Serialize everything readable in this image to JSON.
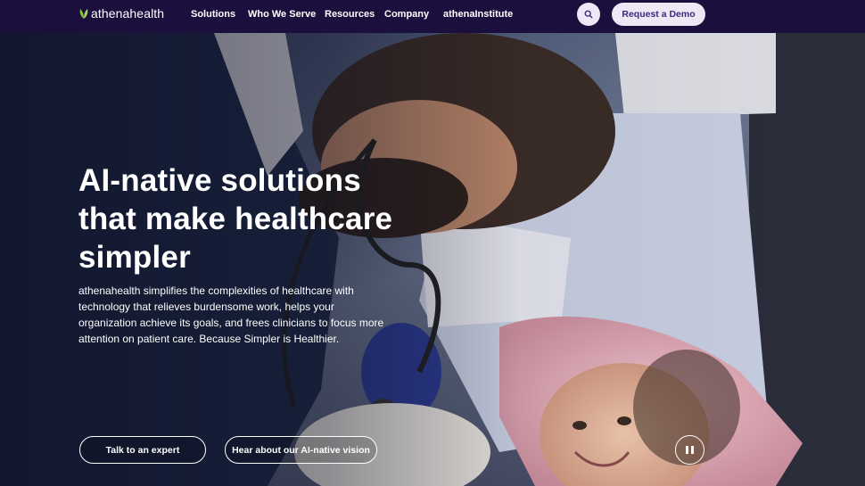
{
  "nav": {
    "logo_text": "athenahealth",
    "links": [
      "Solutions",
      "Who We Serve",
      "Resources",
      "Company",
      "athenaInstitute"
    ],
    "search_icon": "search-icon",
    "demo_label": "Request a Demo"
  },
  "hero": {
    "headline": "AI-native solutions that make healthcare simpler",
    "body": "athenahealth simplifies the complexities of healthcare with technology that relieves burdensome work, helps your organization achieve its goals, and frees clinicians to focus more attention on patient care. Because Simpler is Healthier.",
    "cta_primary": "Talk to an expert",
    "cta_secondary": "Hear about our AI-native vision",
    "pause_icon": "pause-icon"
  },
  "colors": {
    "nav_bg": "#1b0f3d",
    "button_bg": "#ece8f6",
    "button_text": "#3d2a7a",
    "logo_leaf": "#7fbf3f"
  }
}
